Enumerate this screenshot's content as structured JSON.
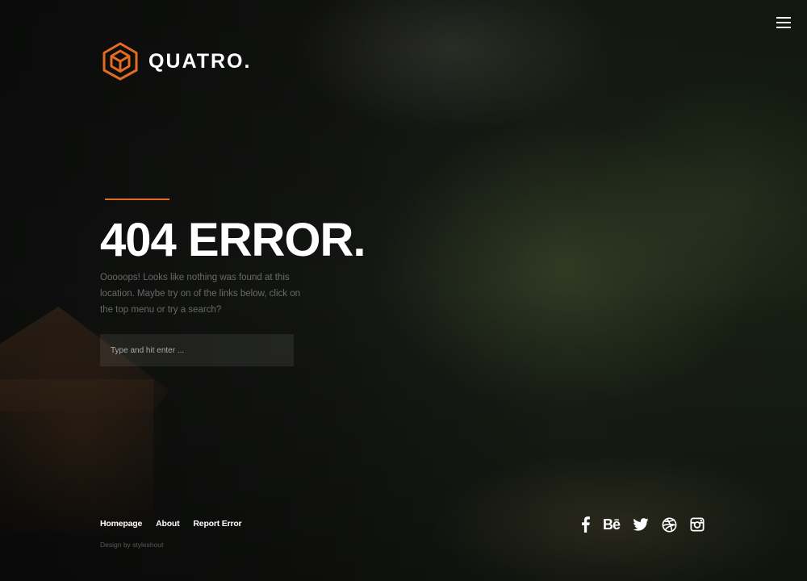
{
  "brand": {
    "name": "QUATRO.",
    "accent_color": "#e46b21"
  },
  "nav": {
    "menu_icon": "hamburger-menu-icon"
  },
  "hero": {
    "title": "404 ERROR.",
    "description": "Ooooops! Looks like nothing was found at this location. Maybe try on of the links below, click on the top menu or try a search?"
  },
  "search": {
    "placeholder": "Type and hit enter ...",
    "value": ""
  },
  "footer": {
    "links": [
      {
        "label": "Homepage"
      },
      {
        "label": "About"
      },
      {
        "label": "Report Error"
      }
    ],
    "credit_prefix": "Design by ",
    "credit_author": "styleshout"
  },
  "social": [
    {
      "icon": "facebook-icon"
    },
    {
      "icon": "behance-icon",
      "text": "Bē"
    },
    {
      "icon": "twitter-icon"
    },
    {
      "icon": "dribbble-icon"
    },
    {
      "icon": "instagram-icon"
    }
  ]
}
